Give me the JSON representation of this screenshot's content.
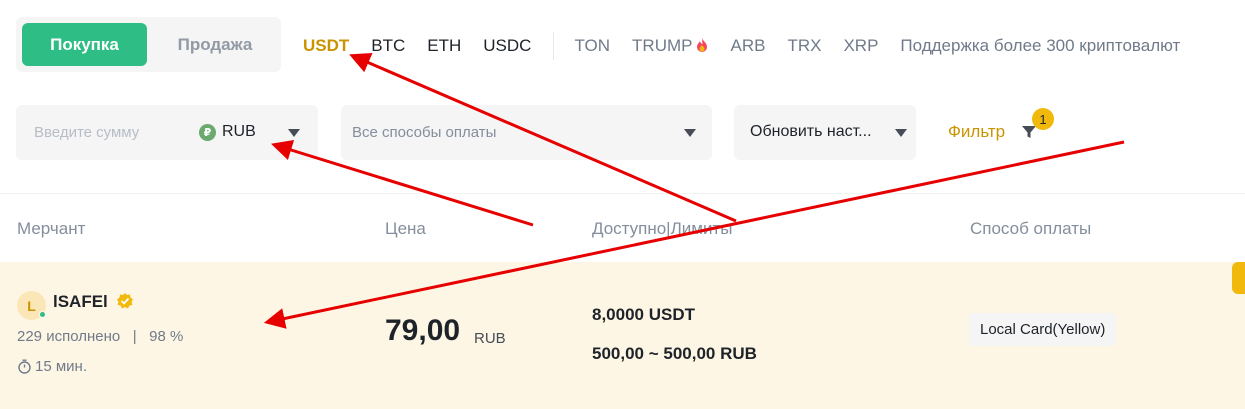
{
  "mode": {
    "buy": "Покупка",
    "sell": "Продажа"
  },
  "coins": {
    "main": [
      "USDT",
      "BTC",
      "ETH",
      "USDC"
    ],
    "extra": [
      "TON",
      "TRUMP",
      "ARB",
      "TRX",
      "XRP"
    ],
    "support": "Поддержка более 300 криптовалют"
  },
  "filters": {
    "amount_placeholder": "Введите сумму",
    "currency_symbol": "₽",
    "currency": "RUB",
    "payment_placeholder": "Все способы оплаты",
    "refresh_label": "Обновить наст...",
    "filter_label": "Фильтр",
    "filter_count": "1"
  },
  "table": {
    "headers": [
      "Мерчант",
      "Цена",
      "Доступно|Лимиты",
      "Способ оплаты"
    ],
    "rows": [
      {
        "avatar_letter": "L",
        "merchant": "lSAFEl",
        "orders": "229 исполнено",
        "completion": "98 %",
        "time": "15 мин.",
        "price": "79,00",
        "price_unit": "RUB",
        "available": "8,0000 USDT",
        "limits": "500,00 ~ 500,00 RUB",
        "payment_method": "Local Card(Yellow)"
      }
    ]
  },
  "colors": {
    "accent": "#c99400",
    "buy": "#2ebd85",
    "arrow": "#e60000",
    "row_bg": "#fef6e4"
  },
  "icons": [
    "fire-icon",
    "rub-icon",
    "chevron-down-icon",
    "filter-icon",
    "verified-icon",
    "timer-icon"
  ]
}
